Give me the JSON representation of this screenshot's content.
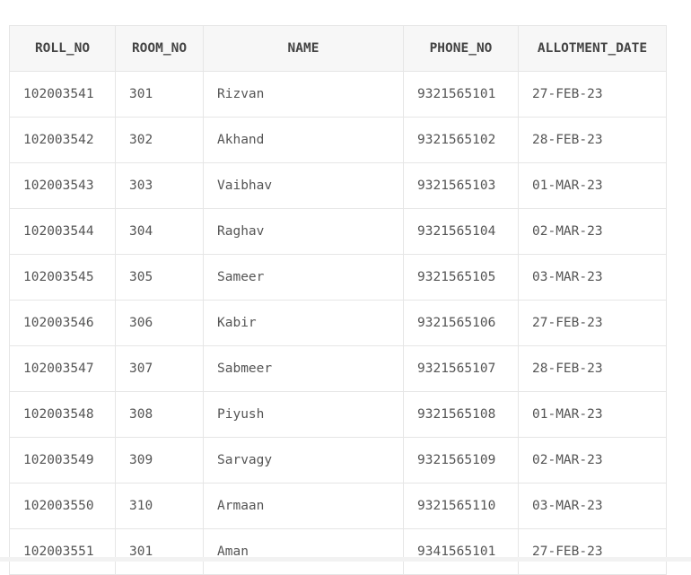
{
  "table": {
    "columns": [
      "ROLL_NO",
      "ROOM_NO",
      "NAME",
      "PHONE_NO",
      "ALLOTMENT_DATE"
    ],
    "rows": [
      [
        "102003541",
        "301",
        "Rizvan",
        "9321565101",
        "27-FEB-23"
      ],
      [
        "102003542",
        "302",
        "Akhand",
        "9321565102",
        "28-FEB-23"
      ],
      [
        "102003543",
        "303",
        "Vaibhav",
        "9321565103",
        "01-MAR-23"
      ],
      [
        "102003544",
        "304",
        "Raghav",
        "9321565104",
        "02-MAR-23"
      ],
      [
        "102003545",
        "305",
        "Sameer",
        "9321565105",
        "03-MAR-23"
      ],
      [
        "102003546",
        "306",
        "Kabir",
        "9321565106",
        "27-FEB-23"
      ],
      [
        "102003547",
        "307",
        "Sabmeer",
        "9321565107",
        "28-FEB-23"
      ],
      [
        "102003548",
        "308",
        "Piyush",
        "9321565108",
        "01-MAR-23"
      ],
      [
        "102003549",
        "309",
        "Sarvagy",
        "9321565109",
        "02-MAR-23"
      ],
      [
        "102003550",
        "310",
        "Armaan",
        "9321565110",
        "03-MAR-23"
      ],
      [
        "102003551",
        "301",
        "Aman",
        "9341565101",
        "27-FEB-23"
      ]
    ]
  }
}
